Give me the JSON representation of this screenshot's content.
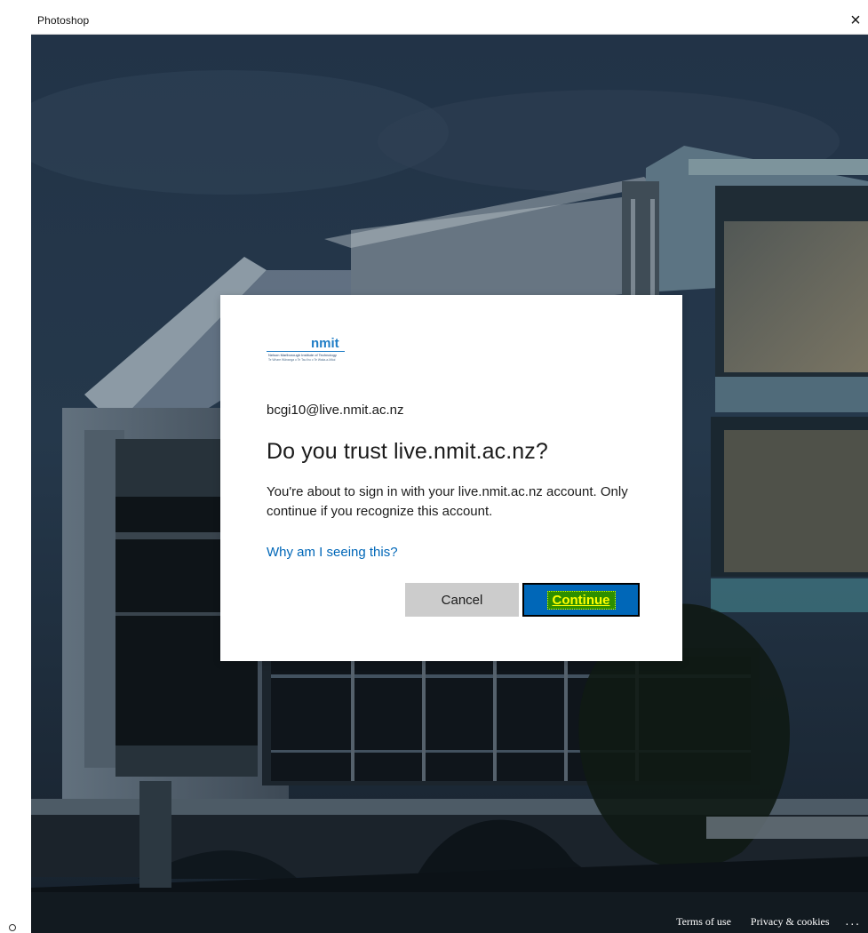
{
  "window": {
    "title": "Photoshop",
    "close_glyph": "×"
  },
  "dialog": {
    "logo_text": "nmit",
    "logo_subtext_line1": "Nelson Marlborough Institute of Technology",
    "logo_subtext_line2": "Te Whare Wānanga o Te Tau Ihu o Te Waka-a-Māui",
    "account_email": "bcgi10@live.nmit.ac.nz",
    "title": "Do you trust live.nmit.ac.nz?",
    "message": "You're about to sign in with your live.nmit.ac.nz account. Only continue if you recognize this account.",
    "why_link": "Why am I seeing this?",
    "cancel_label": "Cancel",
    "continue_label": "Continue"
  },
  "footer": {
    "terms_label": "Terms of use",
    "privacy_label": "Privacy & cookies",
    "more_label": "..."
  },
  "colors": {
    "link": "#0067b8",
    "primary_button": "#0067b8",
    "highlight": "#2d8f00",
    "highlight_text": "#ffff00",
    "cancel_button": "#cccccc"
  },
  "icons": {
    "close": "close-icon",
    "more": "more-icon"
  }
}
